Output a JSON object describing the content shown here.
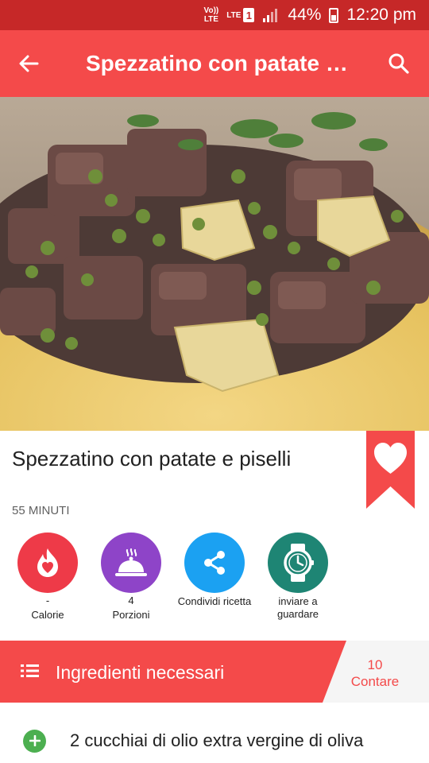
{
  "status_bar": {
    "volte_label": "Vo)) LTE",
    "network_label": "LTE",
    "sim_slot": "1",
    "battery_percent": "44%",
    "time": "12:20 pm",
    "signal_icon": "signal-icon",
    "battery_icon": "battery-charging-icon"
  },
  "app_bar": {
    "title": "Spezzatino con patate e piselli",
    "back_icon": "arrow-back-icon",
    "search_icon": "search-icon"
  },
  "recipe": {
    "title": "Spezzatino con patate e piselli",
    "time": "55 MINUTI",
    "favorite_icon": "heart-icon"
  },
  "actions": [
    {
      "value": "-",
      "label": "Calorie",
      "icon": "flame-icon",
      "color": "#ee3a48"
    },
    {
      "value": "4",
      "label": "Porzioni",
      "icon": "cloche-icon",
      "color": "#8e44c8"
    },
    {
      "value": "",
      "label": "Condividi ricetta",
      "icon": "share-icon",
      "color": "#1ba1f2"
    },
    {
      "value": "",
      "label": "inviare a guardare",
      "icon": "watch-icon",
      "color": "#1e8574"
    }
  ],
  "ingredients": {
    "header_label": "Ingredienti necessari",
    "count": "10",
    "count_label": "Contare",
    "items": [
      {
        "text": "2 cucchiai di olio extra vergine di oliva"
      }
    ]
  },
  "colors": {
    "status_bar": "#c62828",
    "app_bar": "#f44a4a",
    "accent": "#f44a4a",
    "add_green": "#4caf50"
  }
}
